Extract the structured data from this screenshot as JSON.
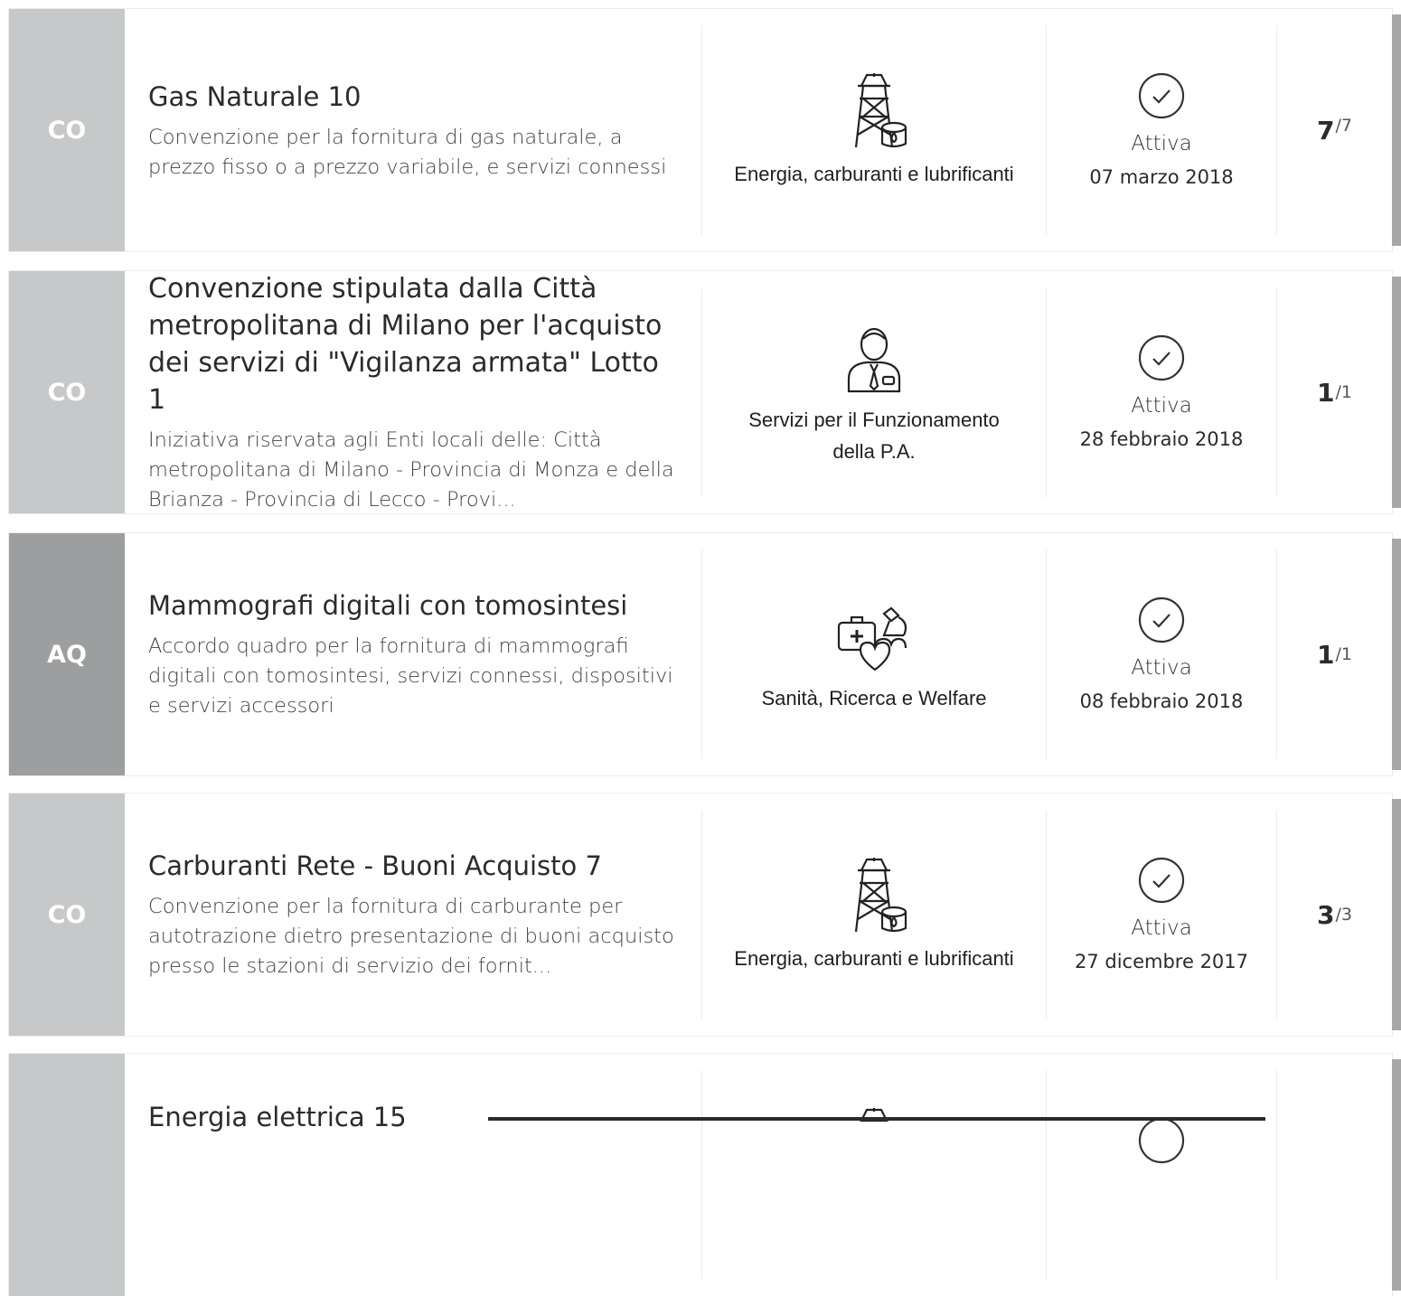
{
  "rows": [
    {
      "badge": "CO",
      "title": "Gas Naturale 10",
      "description": "Convenzione per la fornitura di gas naturale, a prezzo fisso o a prezzo variabile, e servizi connessi",
      "category_icon": "power-pylon-fuel-icon",
      "category": "Energia, carburanti e lubrificanti",
      "status": "Attiva",
      "date": "07 marzo 2018",
      "count": "7",
      "total": "/7"
    },
    {
      "badge": "CO",
      "title": "Convenzione stipulata dalla Città metropolitana di Milano per l'acquisto dei servizi di \"Vigilanza armata\" Lotto 1",
      "description": "Iniziativa riservata agli Enti locali delle: Città metropolitana di Milano - Provincia di Monza e della Brianza - Provincia di Lecco - Provi...",
      "category_icon": "officer-icon",
      "category": "Servizi per il Funzionamento della P.A.",
      "status": "Attiva",
      "date": "28 febbraio 2018",
      "count": "1",
      "total": "/1"
    },
    {
      "badge": "AQ",
      "title": "Mammografi digitali con tomosintesi",
      "description": "Accordo quadro per la fornitura di mammografi digitali con tomosintesi, servizi connessi, dispositivi e servizi accessori",
      "category_icon": "medical-kit-heart-microscope-icon",
      "category": "Sanità, Ricerca e Welfare",
      "status": "Attiva",
      "date": "08 febbraio 2018",
      "count": "1",
      "total": "/1"
    },
    {
      "badge": "CO",
      "title": "Carburanti Rete - Buoni Acquisto 7",
      "description": "Convenzione per la fornitura di carburante per autotrazione dietro presentazione di buoni acquisto presso le stazioni di servizio dei fornit...",
      "category_icon": "power-pylon-fuel-icon",
      "category": "Energia, carburanti e lubrificanti",
      "status": "Attiva",
      "date": "27 dicembre 2017",
      "count": "3",
      "total": "/3"
    },
    {
      "badge": "",
      "title": "Energia elettrica 15",
      "description": "",
      "category_icon": "power-pylon-fuel-icon",
      "category": "",
      "status": "",
      "date": "",
      "count": "",
      "total": ""
    }
  ]
}
